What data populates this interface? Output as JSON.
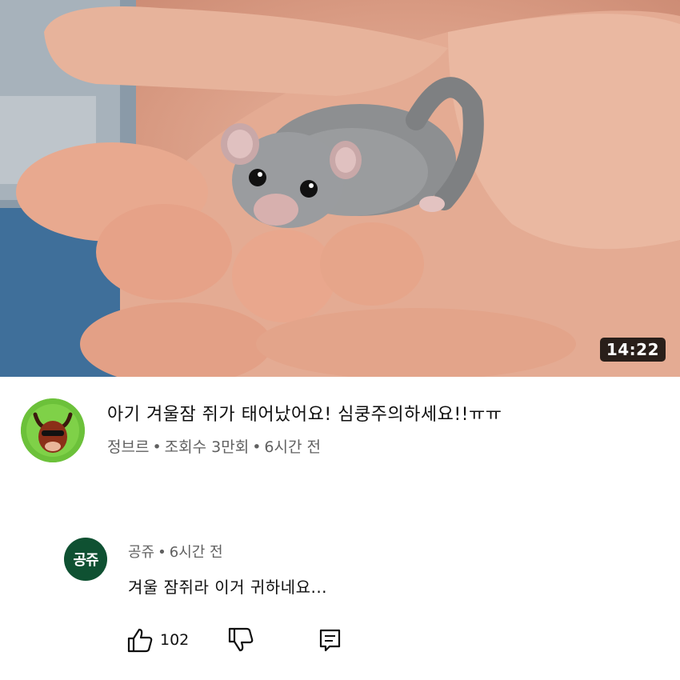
{
  "video": {
    "duration": "14:22",
    "title": "아기 겨울잠 쥐가 태어났어요! 심쿵주의하세요!!ㅠㅠ",
    "channel": "정브르",
    "views": "조회수 3만회",
    "age": "6시간 전",
    "meta_separator": "•"
  },
  "comment": {
    "avatar_text": "공쥬",
    "author": "공쥬",
    "age": "6시간 전",
    "text": "겨울 잠쥐라 이거 귀하네요...",
    "like_count": "102",
    "separator": "•"
  },
  "icons": {
    "like": "thumbs-up-icon",
    "dislike": "thumbs-down-icon",
    "reply": "reply-comment-icon"
  },
  "colors": {
    "comment_avatar_bg": "#0f5132",
    "channel_avatar_bg": "#6cc13a",
    "meta_text": "#606060"
  }
}
